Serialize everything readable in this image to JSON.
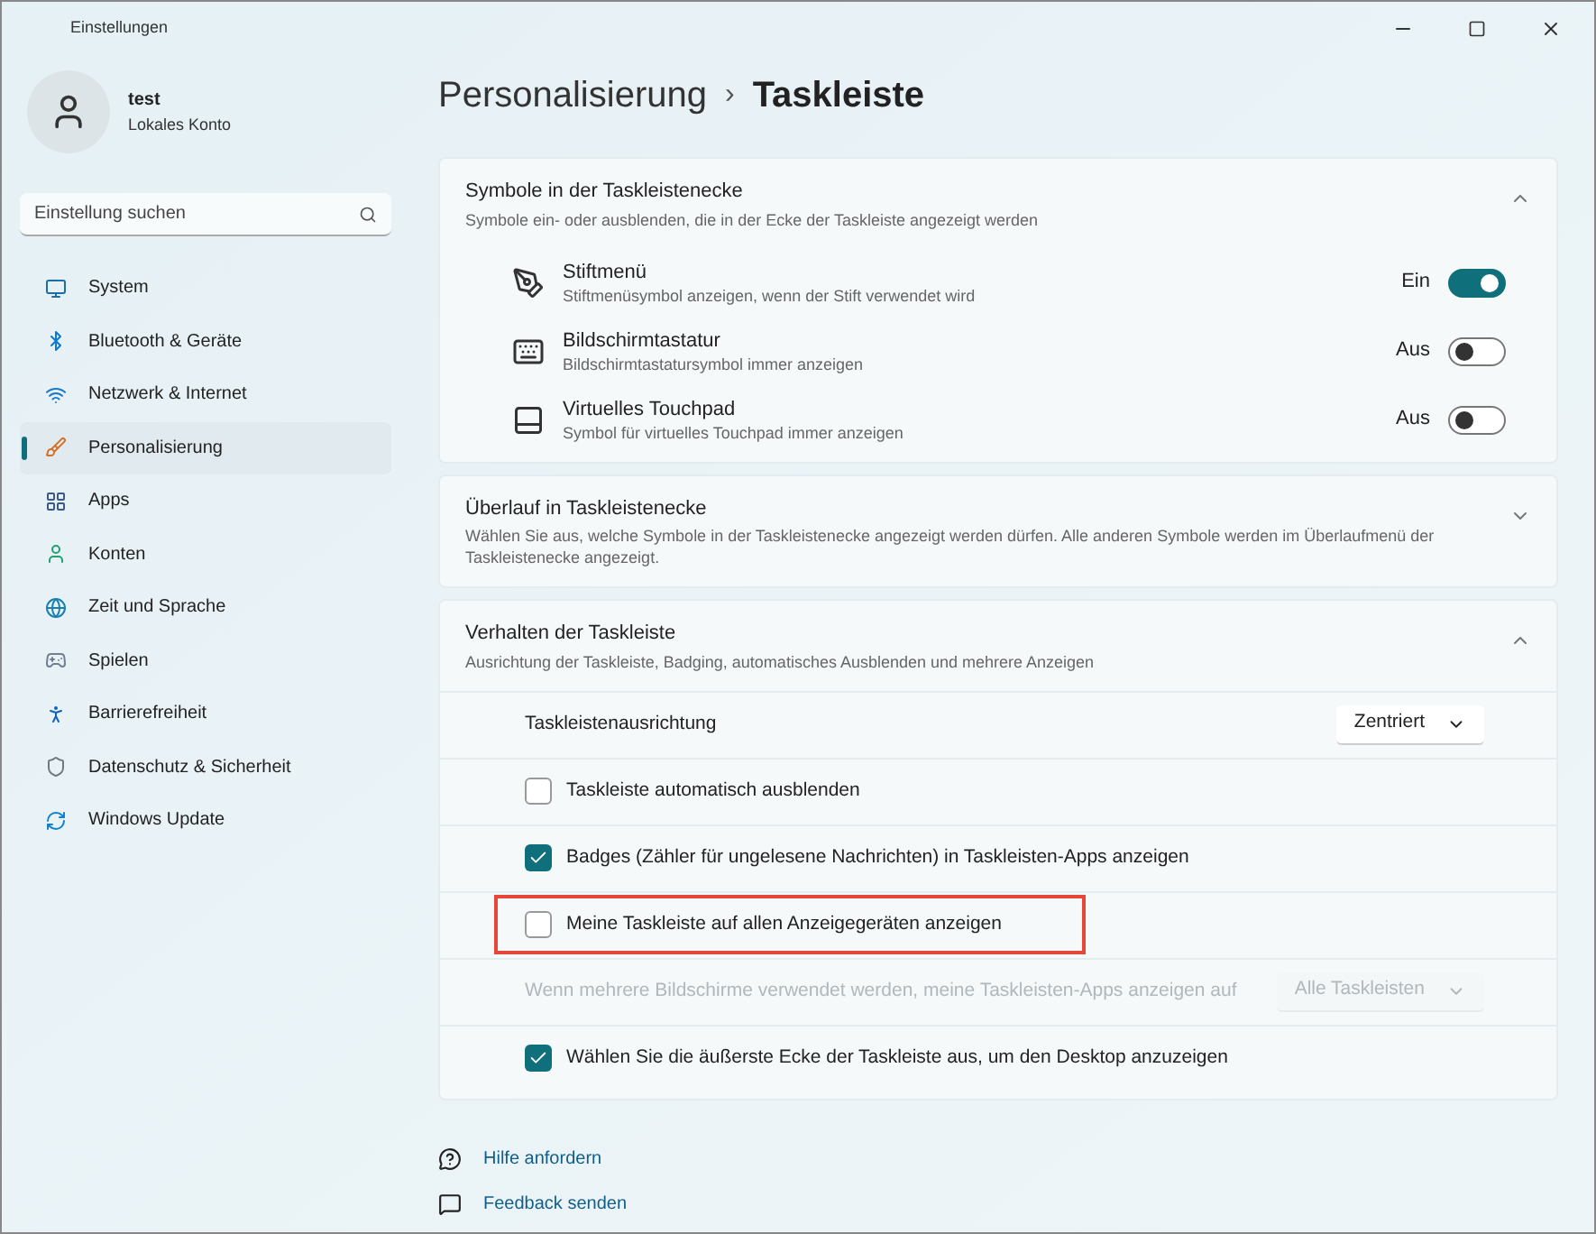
{
  "window": {
    "title": "Einstellungen"
  },
  "user": {
    "name": "test",
    "account": "Lokales Konto"
  },
  "search": {
    "placeholder": "Einstellung suchen"
  },
  "sidebar": {
    "items": [
      {
        "label": "System",
        "selected": false
      },
      {
        "label": "Bluetooth & Geräte",
        "selected": false
      },
      {
        "label": "Netzwerk & Internet",
        "selected": false
      },
      {
        "label": "Personalisierung",
        "selected": true
      },
      {
        "label": "Apps",
        "selected": false
      },
      {
        "label": "Konten",
        "selected": false
      },
      {
        "label": "Zeit und Sprache",
        "selected": false
      },
      {
        "label": "Spielen",
        "selected": false
      },
      {
        "label": "Barrierefreiheit",
        "selected": false
      },
      {
        "label": "Datenschutz & Sicherheit",
        "selected": false
      },
      {
        "label": "Windows Update",
        "selected": false
      }
    ]
  },
  "breadcrumb": {
    "parent": "Personalisierung",
    "separator": "›",
    "current": "Taskleiste"
  },
  "sections": [
    {
      "title": "Symbole in der Taskleistenecke",
      "subtitle": "Symbole ein- oder ausblenden, die in der Ecke der Taskleiste angezeigt werden",
      "expanded": true,
      "items": [
        {
          "kind": "toggle",
          "label": "Stiftmenü",
          "description": "Stiftmenüsymbol anzeigen, wenn der Stift verwendet wird",
          "on": true,
          "state_label": "Ein"
        },
        {
          "kind": "toggle",
          "label": "Bildschirmtastatur",
          "description": "Bildschirmtastatursymbol immer anzeigen",
          "on": false,
          "state_label": "Aus"
        },
        {
          "kind": "toggle",
          "label": "Virtuelles Touchpad",
          "description": "Symbol für virtuelles Touchpad immer anzeigen",
          "on": false,
          "state_label": "Aus"
        }
      ]
    },
    {
      "title": "Überlauf in Taskleistenecke",
      "subtitle": "Wählen Sie aus, welche Symbole in der Taskleistenecke angezeigt werden dürfen. Alle anderen Symbole werden im Überlaufmenü der Taskleistenecke angezeigt.",
      "expanded": false
    },
    {
      "title": "Verhalten der Taskleiste",
      "subtitle": "Ausrichtung der Taskleiste, Badging, automatisches Ausblenden und mehrere Anzeigen",
      "expanded": true,
      "items": [
        {
          "kind": "dropdown",
          "label": "Taskleistenausrichtung",
          "value": "Zentriert",
          "disabled": false
        },
        {
          "kind": "checkbox",
          "label": "Taskleiste automatisch ausblenden",
          "checked": false,
          "highlighted": false
        },
        {
          "kind": "checkbox",
          "label": "Badges (Zähler für ungelesene Nachrichten) in Taskleisten-Apps anzeigen",
          "checked": true,
          "highlighted": false
        },
        {
          "kind": "checkbox",
          "label": "Meine Taskleiste auf allen Anzeigegeräten anzeigen",
          "checked": false,
          "highlighted": true
        },
        {
          "kind": "dropdown",
          "label": "Wenn mehrere Bildschirme verwendet werden, meine Taskleisten-Apps anzeigen auf",
          "value": "Alle Taskleisten",
          "disabled": true
        },
        {
          "kind": "checkbox",
          "label": "Wählen Sie die äußerste Ecke der Taskleiste aus, um den Desktop anzuzeigen",
          "checked": true,
          "highlighted": false
        }
      ]
    }
  ],
  "links": [
    {
      "label": "Hilfe anfordern"
    },
    {
      "label": "Feedback senden"
    }
  ]
}
